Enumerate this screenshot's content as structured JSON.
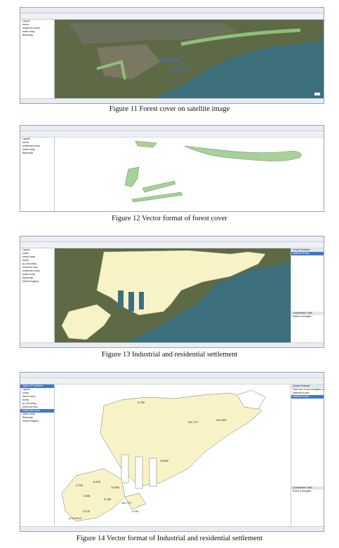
{
  "figures": [
    {
      "caption": "Figure 11 Forest cover on satellite image",
      "menu": [
        "File",
        "Edit",
        "View",
        "Bookmarks",
        "Insert",
        "Selection",
        "Geoprocessing",
        "Customize",
        "Windows",
        "Help"
      ],
      "toc": [
        "Layers",
        "forest",
        "settlement area",
        "water body",
        "Basemap"
      ]
    },
    {
      "caption": "Figure 12 Vector format of forest cover",
      "menu": [
        "File",
        "Edit",
        "View",
        "Bookmarks",
        "Insert",
        "Selection",
        "Geoprocessing",
        "Customize",
        "Windows",
        "Help"
      ],
      "toc": [
        "Layers",
        "forest",
        "settlement area",
        "water body",
        "Basemap"
      ]
    },
    {
      "caption": "Figure 13 Industrial and residential settlement",
      "menu": [
        "File",
        "Edit",
        "View",
        "Bookmarks",
        "Insert",
        "Selection",
        "Geoprocessing",
        "Customize",
        "Windows",
        "Help"
      ],
      "toc": [
        "Layers",
        "roads",
        "beach area",
        "forest",
        "pt_boundary",
        "reserved land",
        "settlement area",
        "water body",
        "Basemap",
        "World Imagery"
      ],
      "right_panel": {
        "title": "Create Features",
        "item1": "settlement area",
        "footer": "Construction Tools",
        "footer_item": "Select a template."
      }
    },
    {
      "caption": "Figure 14 Vector format of  Industrial and residential settlement",
      "menu": [
        "File",
        "Edit",
        "View",
        "Bookmarks",
        "Insert",
        "Selection",
        "Geoprocessing",
        "Customize",
        "Windows",
        "Help"
      ],
      "toc": [
        "Table Of Contents",
        "Layers",
        "roads",
        "beach area",
        "forest",
        "pt_boundary",
        "reserved land",
        "settlement area",
        "water body",
        "Basemap",
        "World Imagery"
      ],
      "right_panel": {
        "title": "Create Features",
        "item1": "Click here to see templates not listed",
        "item2": "settlement area",
        "item3": "settlement area",
        "footer": "Construction Tools",
        "footer_item": "Select a template."
      },
      "labels": [
        "6.755",
        "261.727",
        "204.483",
        "2.6592",
        "5.678",
        "3.756",
        "10.851",
        "1.006",
        "5.755",
        "161.727",
        "3.176",
        "1.011",
        "3.00.8710"
      ]
    }
  ],
  "colors": {
    "forest_green": "#8fbf7a",
    "settlement": "#f7f3c6",
    "water": "#3d6f7d",
    "land": "#5d6a45"
  }
}
